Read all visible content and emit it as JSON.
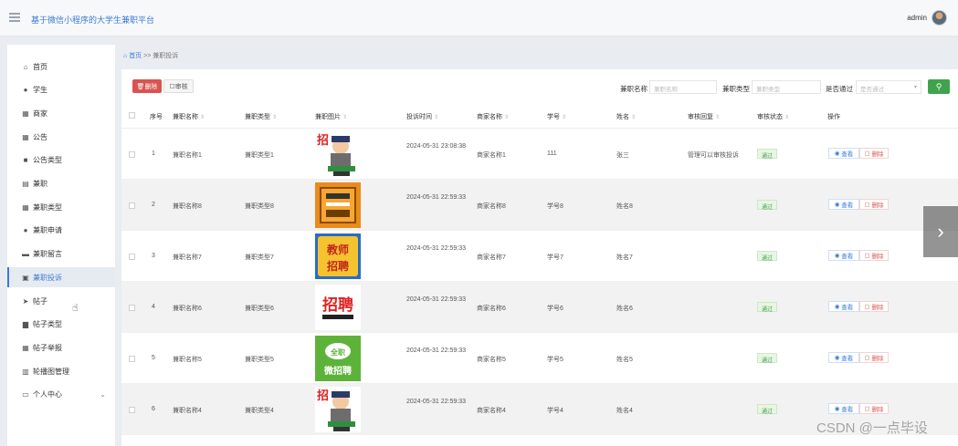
{
  "header": {
    "title": "基于微信小程序的大学生兼职平台",
    "user": "admin"
  },
  "sidebar": {
    "items": [
      {
        "label": "首页",
        "icon": "home-icon",
        "glyph": "⌂"
      },
      {
        "label": "学生",
        "icon": "user-icon",
        "glyph": "●"
      },
      {
        "label": "商家",
        "icon": "grid-icon",
        "glyph": "▦"
      },
      {
        "label": "公告",
        "icon": "grid-icon",
        "glyph": "▦"
      },
      {
        "label": "公告类型",
        "icon": "message-icon",
        "glyph": "■"
      },
      {
        "label": "兼职",
        "icon": "list-icon",
        "glyph": "▤"
      },
      {
        "label": "兼职类型",
        "icon": "grid-icon",
        "glyph": "▦"
      },
      {
        "label": "兼职申请",
        "icon": "user-icon",
        "glyph": "●"
      },
      {
        "label": "兼职留言",
        "icon": "print-icon",
        "glyph": "▬"
      },
      {
        "label": "兼职投诉",
        "icon": "picture-icon",
        "glyph": "▣"
      },
      {
        "label": "帖子",
        "icon": "send-icon",
        "glyph": "➤"
      },
      {
        "label": "帖子类型",
        "icon": "monitor-icon",
        "glyph": "▆"
      },
      {
        "label": "帖子举报",
        "icon": "grid-icon",
        "glyph": "▦"
      },
      {
        "label": "轮播图管理",
        "icon": "bar-chart-icon",
        "glyph": "▥"
      },
      {
        "label": "个人中心",
        "icon": "card-icon",
        "glyph": "▭"
      }
    ],
    "active_index": 9
  },
  "breadcrumb": {
    "home": "首页",
    "separator": ">>",
    "current": "兼职投诉"
  },
  "toolbar": {
    "delete_label": "删除",
    "audit_label": "审核"
  },
  "filters": {
    "name_label": "兼职名称",
    "name_placeholder": "兼职名称",
    "type_label": "兼职类型",
    "type_placeholder": "兼职类型",
    "passed_label": "是否通过",
    "passed_placeholder": "是否通过"
  },
  "table": {
    "headers": [
      "序号",
      "兼职名称",
      "兼职类型",
      "兼职图片",
      "投诉时间",
      "商家名称",
      "学号",
      "姓名",
      "审核回复",
      "审核状态",
      "操作"
    ],
    "rows": [
      {
        "no": "1",
        "job": "兼职名称1",
        "type": "兼职类型1",
        "time": "2024-05-31 23:08:38",
        "merchant": "商家名称1",
        "sid": "111",
        "name": "张三",
        "reply": "管理可以审核投诉",
        "status": "通过",
        "img": "cartoon"
      },
      {
        "no": "2",
        "job": "兼职名称8",
        "type": "兼职类型8",
        "time": "2024-05-31 22:59:33",
        "merchant": "商家名称8",
        "sid": "学号8",
        "name": "姓名8",
        "reply": "",
        "status": "通过",
        "img": "orange"
      },
      {
        "no": "3",
        "job": "兼职名称7",
        "type": "兼职类型7",
        "time": "2024-05-31 22:59:33",
        "merchant": "商家名称7",
        "sid": "学号7",
        "name": "姓名7",
        "reply": "",
        "status": "通过",
        "img": "teacher"
      },
      {
        "no": "4",
        "job": "兼职名称6",
        "type": "兼职类型6",
        "time": "2024-05-31 22:59:33",
        "merchant": "商家名称6",
        "sid": "学号6",
        "name": "姓名6",
        "reply": "",
        "status": "通过",
        "img": "zhaopin"
      },
      {
        "no": "5",
        "job": "兼职名称5",
        "type": "兼职类型5",
        "time": "2024-05-31 22:59:33",
        "merchant": "商家名称5",
        "sid": "学号5",
        "name": "姓名5",
        "reply": "",
        "status": "通过",
        "img": "green"
      },
      {
        "no": "6",
        "job": "兼职名称4",
        "type": "兼职类型4",
        "time": "2024-05-31 22:59:33",
        "merchant": "商家名称4",
        "sid": "学号4",
        "name": "姓名4",
        "reply": "",
        "status": "通过",
        "img": "cartoon"
      }
    ],
    "view_label": "查看",
    "delete_label": "删除"
  },
  "images": {
    "cartoon_text": "招",
    "teacher_text": [
      "教师",
      "招聘"
    ],
    "zhaopin_text": "招聘",
    "green_text": [
      "全职",
      "微招聘"
    ]
  },
  "watermark": "CSDN @一点毕设",
  "colors": {
    "accent": "#3a7bd5",
    "danger": "#d9534f",
    "success": "#3fa34d"
  }
}
